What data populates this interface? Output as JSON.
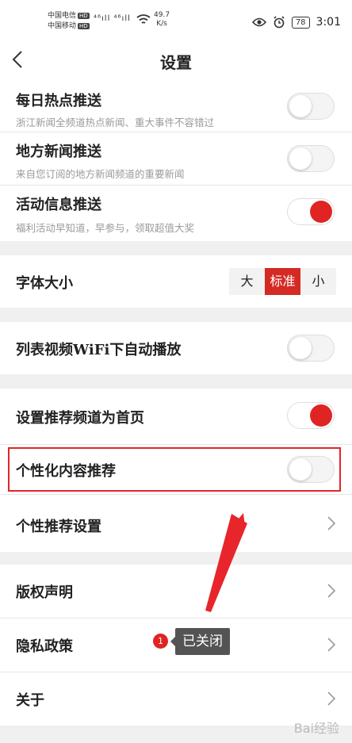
{
  "status_bar": {
    "carrier_1": "中国电信",
    "carrier_2": "中国移动",
    "hd": "HD",
    "signal": "⁴⁶ıll ⁴⁶ıll",
    "speed_value": "49.7",
    "speed_unit": "K/s",
    "battery": "78",
    "time": "3:01"
  },
  "nav": {
    "title": "设置"
  },
  "push": {
    "daily": {
      "title": "每日热点推送",
      "subtitle": "浙江新闻全频道热点新闻、重大事件不容错过",
      "on": false
    },
    "local": {
      "title": "地方新闻推送",
      "subtitle": "来自您订阅的地方新闻频道的重要新闻",
      "on": false
    },
    "activity": {
      "title": "活动信息推送",
      "subtitle": "福利活动早知道，早参与，领取超值大奖",
      "on": true
    }
  },
  "font_size": {
    "title": "字体大小",
    "options": [
      "大",
      "标准",
      "小"
    ],
    "selected": "标准"
  },
  "video": {
    "title": "列表视频WiFi下自动播放",
    "on": false
  },
  "recommend": {
    "home": {
      "title": "设置推荐频道为首页",
      "on": true
    },
    "personalized": {
      "title": "个性化内容推荐",
      "on": false
    },
    "settings": {
      "title": "个性推荐设置"
    }
  },
  "about": {
    "copyright": "版权声明",
    "privacy": "隐私政策",
    "about": "关于"
  },
  "annotation": {
    "badge": "1",
    "tooltip": "已关闭"
  },
  "watermark": "Bai经验",
  "colors": {
    "accent": "#e02424",
    "highlight": "#e0262a"
  }
}
